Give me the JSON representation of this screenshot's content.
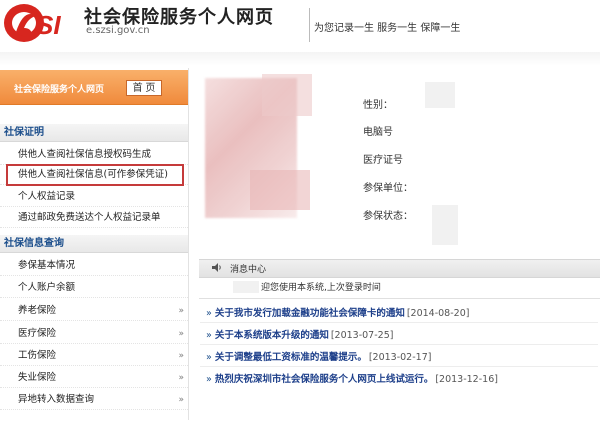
{
  "header": {
    "site_title": "社会保险服务个人网页",
    "site_domain": "e.szsi.gov.cn",
    "slogan": "为您记录一生 服务一生 保障一生"
  },
  "sidebar": {
    "banner_text": "社会保险服务个人网页",
    "home_button": "首 页",
    "sections": [
      {
        "title": "社保证明",
        "items": [
          {
            "label": "供他人查阅社保信息授权码生成"
          },
          {
            "label": "供他人查阅社保信息(可作参保凭证)"
          },
          {
            "label": "个人权益记录"
          },
          {
            "label": "通过邮政免费送达个人权益记录单"
          }
        ]
      },
      {
        "title": "社保信息查询",
        "items": [
          {
            "label": "参保基本情况"
          },
          {
            "label": "个人账户余额"
          },
          {
            "label": "养老保险"
          },
          {
            "label": "医疗保险"
          },
          {
            "label": "工伤保险"
          },
          {
            "label": "失业保险"
          },
          {
            "label": "异地转入数据查询"
          }
        ]
      }
    ]
  },
  "profile": {
    "fields": [
      {
        "label": "性别："
      },
      {
        "label": "电脑号"
      },
      {
        "label": "医疗证号"
      },
      {
        "label": "参保单位："
      },
      {
        "label": "参保状态："
      }
    ]
  },
  "messages": {
    "title": "消息中心",
    "welcome": "迎您使用本系统,上次登录时间"
  },
  "news": [
    {
      "title": "关于我市发行加载金融功能社会保障卡的通知",
      "date": "[2014-08-20]"
    },
    {
      "title": "关于本系统版本升级的通知",
      "date": "[2013-07-25]"
    },
    {
      "title": "关于调整最低工资标准的温馨提示。",
      "date": "[2013-02-17]"
    },
    {
      "title": "热烈庆祝深圳市社会保险服务个人网页上线试运行。",
      "date": "[2013-12-16]"
    }
  ],
  "colors": {
    "logo_red": "#d7261f",
    "banner_orange": "#f08a3c",
    "link_blue": "#1d3f8a",
    "highlight_red": "#c53a3a"
  },
  "icons": [
    "si-logo-icon",
    "speaker-icon",
    "chevron-right-icon"
  ]
}
